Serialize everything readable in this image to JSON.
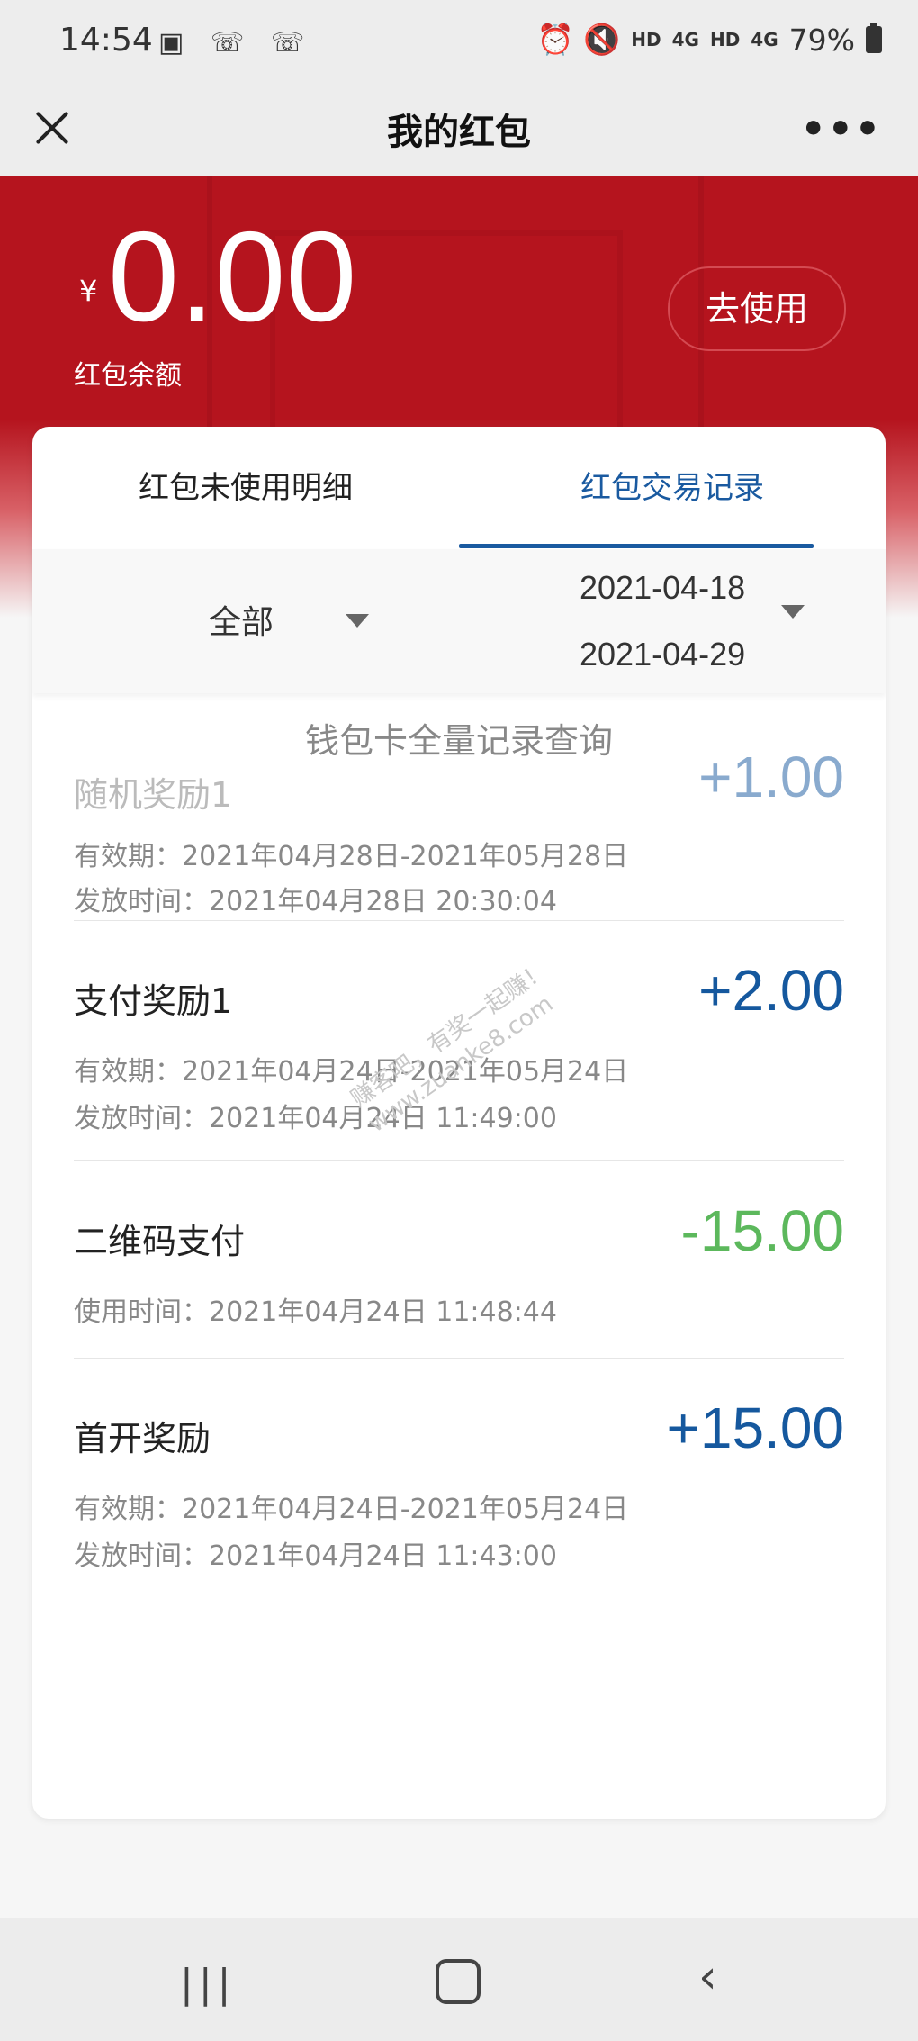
{
  "status_bar": {
    "time": "14:54",
    "icons": "▣ ☏ ☏",
    "right_icons": "⏰ 🔇",
    "hd1": "HD",
    "net1": "4G",
    "hd2": "HD",
    "net2": "4G",
    "battery": "79%"
  },
  "header": {
    "title": "我的红包",
    "close_icon": "close-icon",
    "more_label": "•••"
  },
  "banner": {
    "currency": "¥",
    "amount": "0.00",
    "label": "红包余额",
    "use_button": "去使用",
    "accent": "#b5141e"
  },
  "tabs": [
    {
      "label": "红包未使用明细"
    },
    {
      "label": "红包交易记录"
    }
  ],
  "filter": {
    "type": "全部",
    "start_date": "2021-04-18",
    "end_date": "2021-04-29"
  },
  "query_link": "钱包卡全量记录查询",
  "records": [
    {
      "name": "随机奖励1",
      "amount": "+1.00",
      "lines": [
        "有效期：2021年04月28日-2021年05月28日",
        "发放时间：2021年04月28日 20:30:04"
      ]
    },
    {
      "name": "支付奖励1",
      "amount": "+2.00",
      "lines": [
        "有效期：2021年04月24日-2021年05月24日",
        "发放时间：2021年04月24日 11:49:00"
      ]
    },
    {
      "name": "二维码支付",
      "amount": "-15.00",
      "lines": [
        "使用时间：2021年04月24日 11:48:44"
      ]
    },
    {
      "name": "首开奖励",
      "amount": "+15.00",
      "lines": [
        "有效期：2021年04月24日-2021年05月24日",
        "发放时间：2021年04月24日 11:43:00"
      ]
    }
  ],
  "watermark": {
    "line1": "赚客吧，有奖一起赚！",
    "line2": "www.zuanke8.com"
  },
  "colors": {
    "positive": "#15589e",
    "negative": "#5cb85c",
    "tab_active": "#1a5aa0"
  }
}
